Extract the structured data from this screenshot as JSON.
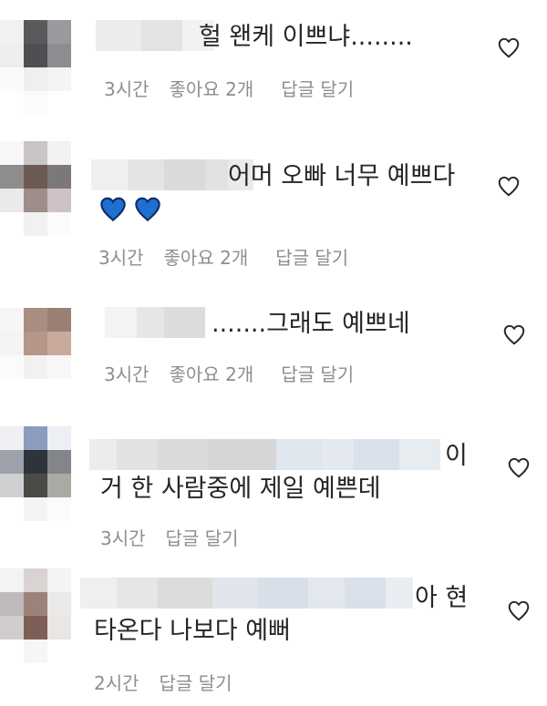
{
  "comments": [
    {
      "text_lines": [
        "헐 왠케 이쁘냐........"
      ],
      "time": "3시간",
      "likes": "좋아요 2개",
      "reply": "답글 달기",
      "emoji_icon": ""
    },
    {
      "text_lines": [
        "어머 오빠 너무 예쁘다"
      ],
      "emoji_icon": "blue-heart-icon",
      "emoji_count": 2,
      "emoji_color": "#1f6fd1",
      "time": "3시간",
      "likes": "좋아요 2개",
      "reply": "답글 달기"
    },
    {
      "text_lines": [
        ".......그래도 예쁘네"
      ],
      "time": "3시간",
      "likes": "좋아요 2개",
      "reply": "답글 달기"
    },
    {
      "text_lines": [
        "이",
        "거 한 사람중에 제일 예쁜데"
      ],
      "time": "3시간",
      "reply": "답글 달기"
    },
    {
      "text_lines": [
        "아 현",
        "타온다 나보다 예뻐"
      ],
      "time": "2시간",
      "reply": "답글 달기"
    }
  ],
  "colors": {
    "text": "#262626",
    "meta": "#8e8e8e",
    "heart_outline": "#262626"
  }
}
